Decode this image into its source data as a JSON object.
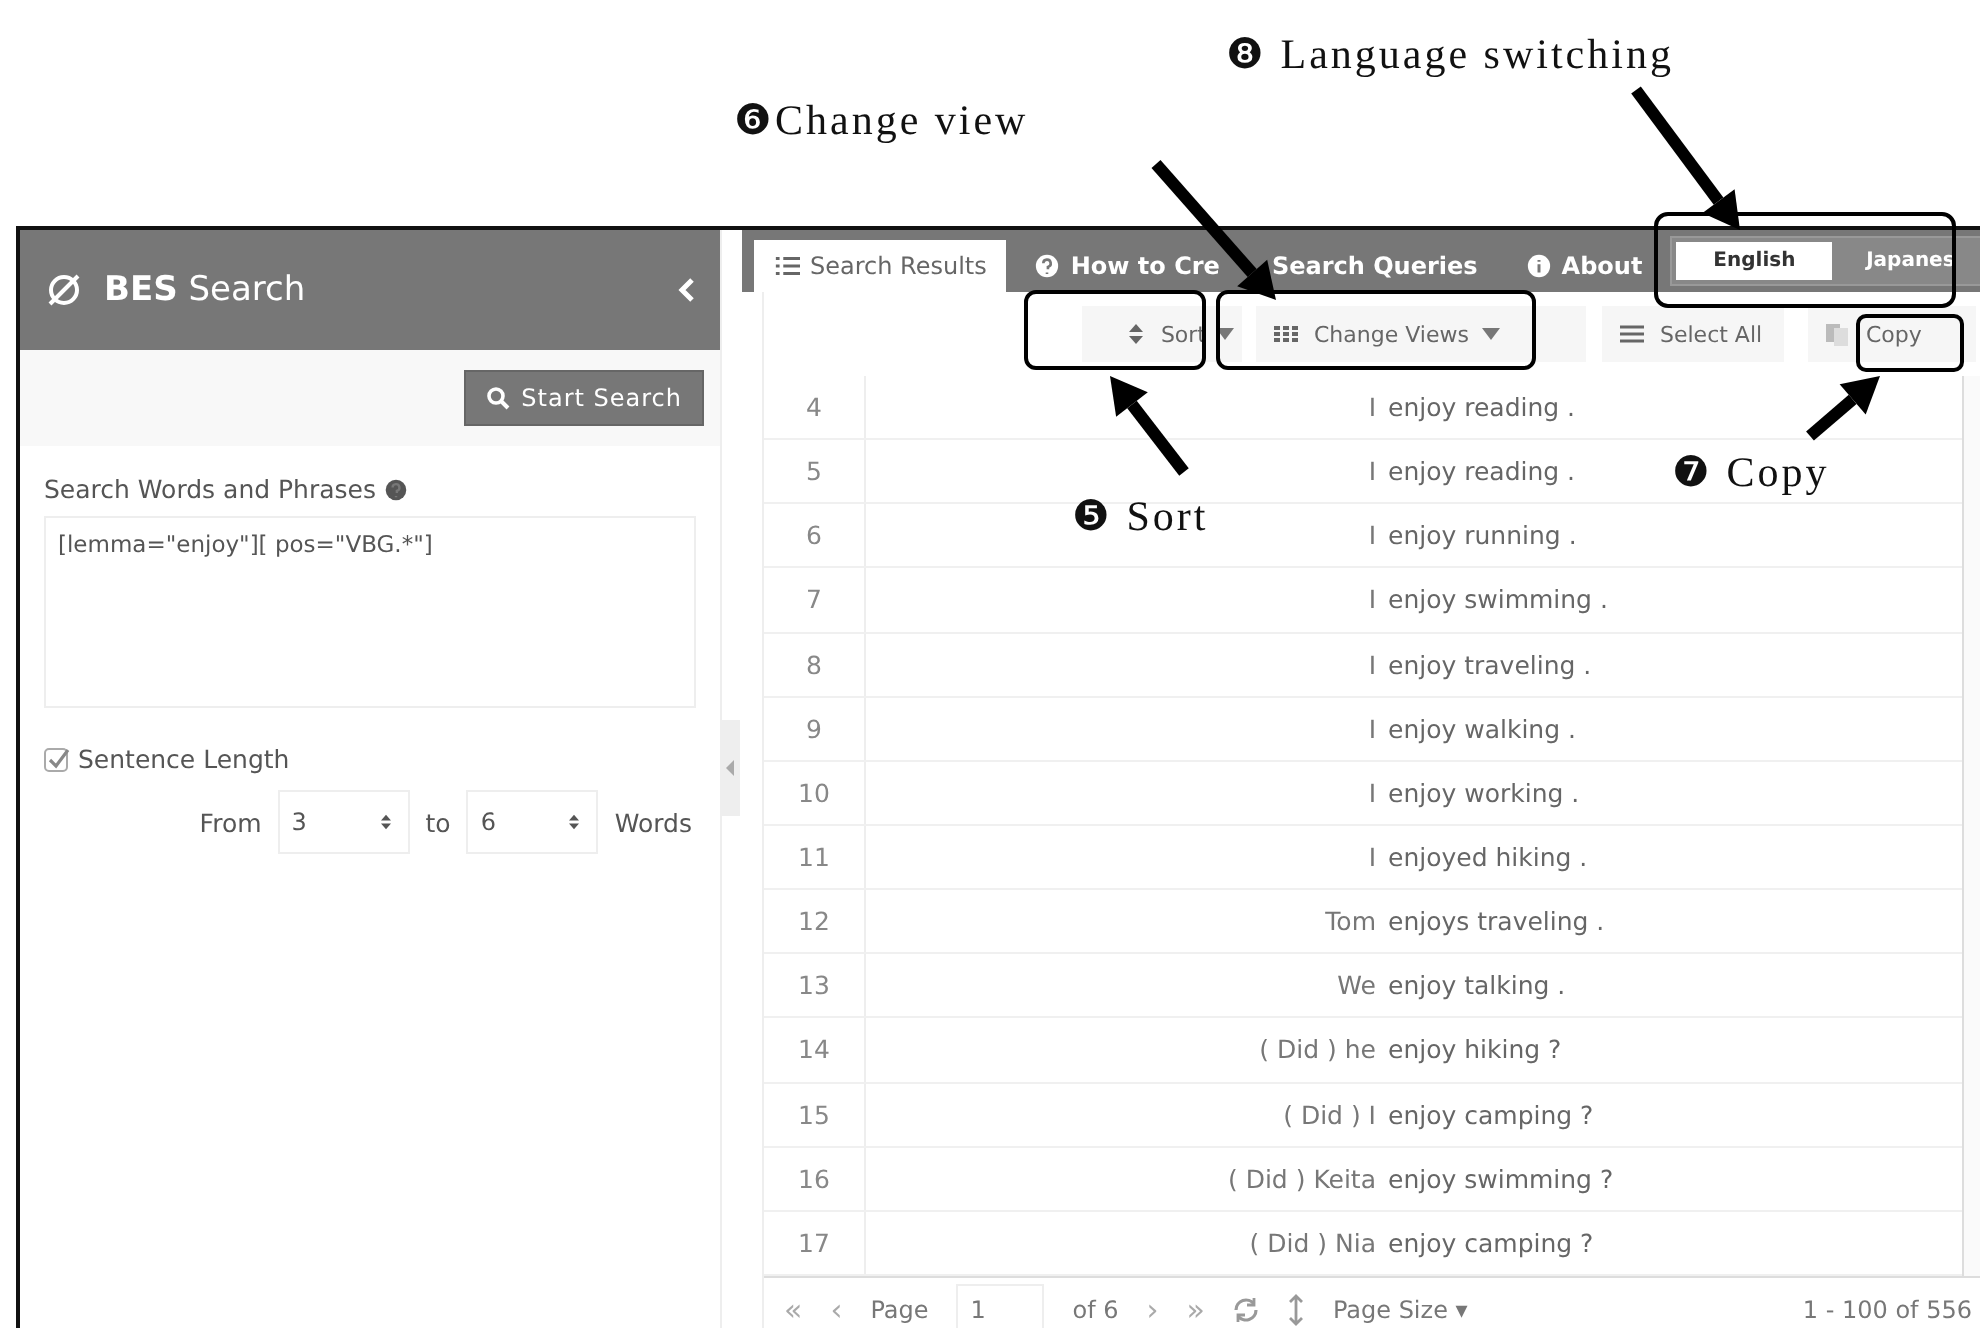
{
  "sidebar": {
    "title_bold": "BES",
    "title": "Search",
    "start_button": "Start Search",
    "query_label": "Search Words and Phrases",
    "query": "[lemma=\"enjoy\"][ pos=\"VBG.*\"]",
    "length_filter": {
      "label": "Sentence Length",
      "checked": true,
      "from_label": "From",
      "from": "3",
      "to_label": "to",
      "to": "6",
      "unit": "Words"
    }
  },
  "tabs": [
    {
      "label": "Search Results",
      "selected": true
    },
    {
      "label": "How to Cre",
      "label_rest": "Search Queries",
      "selected": false
    },
    {
      "label": "About",
      "selected": false
    }
  ],
  "languages": [
    {
      "label": "English",
      "selected": true
    },
    {
      "label": "Japanes",
      "selected": false
    }
  ],
  "toolbar": [
    {
      "label": "Sort",
      "dropdown": true
    },
    {
      "label": "Change Views",
      "dropdown": true
    },
    {
      "label": "Select All",
      "dropdown": false
    },
    {
      "label": "Copy",
      "dropdown": false
    }
  ],
  "rows": [
    {
      "num": "4",
      "left": "I",
      "hit": "enjoy reading ."
    },
    {
      "num": "5",
      "left": "I",
      "hit": "enjoy reading ."
    },
    {
      "num": "6",
      "left": "I",
      "hit": "enjoy running ."
    },
    {
      "num": "7",
      "left": "I",
      "hit": "enjoy swimming ."
    },
    {
      "num": "8",
      "left": "I",
      "hit": "enjoy traveling ."
    },
    {
      "num": "9",
      "left": "I",
      "hit": "enjoy walking ."
    },
    {
      "num": "10",
      "left": "I",
      "hit": "enjoy working ."
    },
    {
      "num": "11",
      "left": "I",
      "hit": "enjoyed hiking ."
    },
    {
      "num": "12",
      "left": "Tom",
      "hit": "enjoys traveling ."
    },
    {
      "num": "13",
      "left": "We",
      "hit": "enjoy talking ."
    },
    {
      "num": "14",
      "left": "( Did ) he",
      "hit": "enjoy hiking ?"
    },
    {
      "num": "15",
      "left": "( Did ) I",
      "hit": "enjoy camping ?"
    },
    {
      "num": "16",
      "left": "( Did ) Keita",
      "hit": "enjoy swimming ?"
    },
    {
      "num": "17",
      "left": "( Did ) Nia",
      "hit": "enjoy camping ?"
    }
  ],
  "pager": {
    "first": "«",
    "prev": "‹",
    "page_label": "Page",
    "page": "1",
    "of": "of 6",
    "next": "›",
    "last": "»",
    "page_size": "Page Size",
    "page_size_caret": "▾",
    "range": "1 - 100 of 556"
  },
  "annotations": [
    {
      "mark": "❻",
      "label": "Change view"
    },
    {
      "mark": "❽",
      "label": "Language switching"
    },
    {
      "mark": "❺",
      "label": "Sort"
    },
    {
      "mark": "❼",
      "label": "Copy"
    }
  ]
}
